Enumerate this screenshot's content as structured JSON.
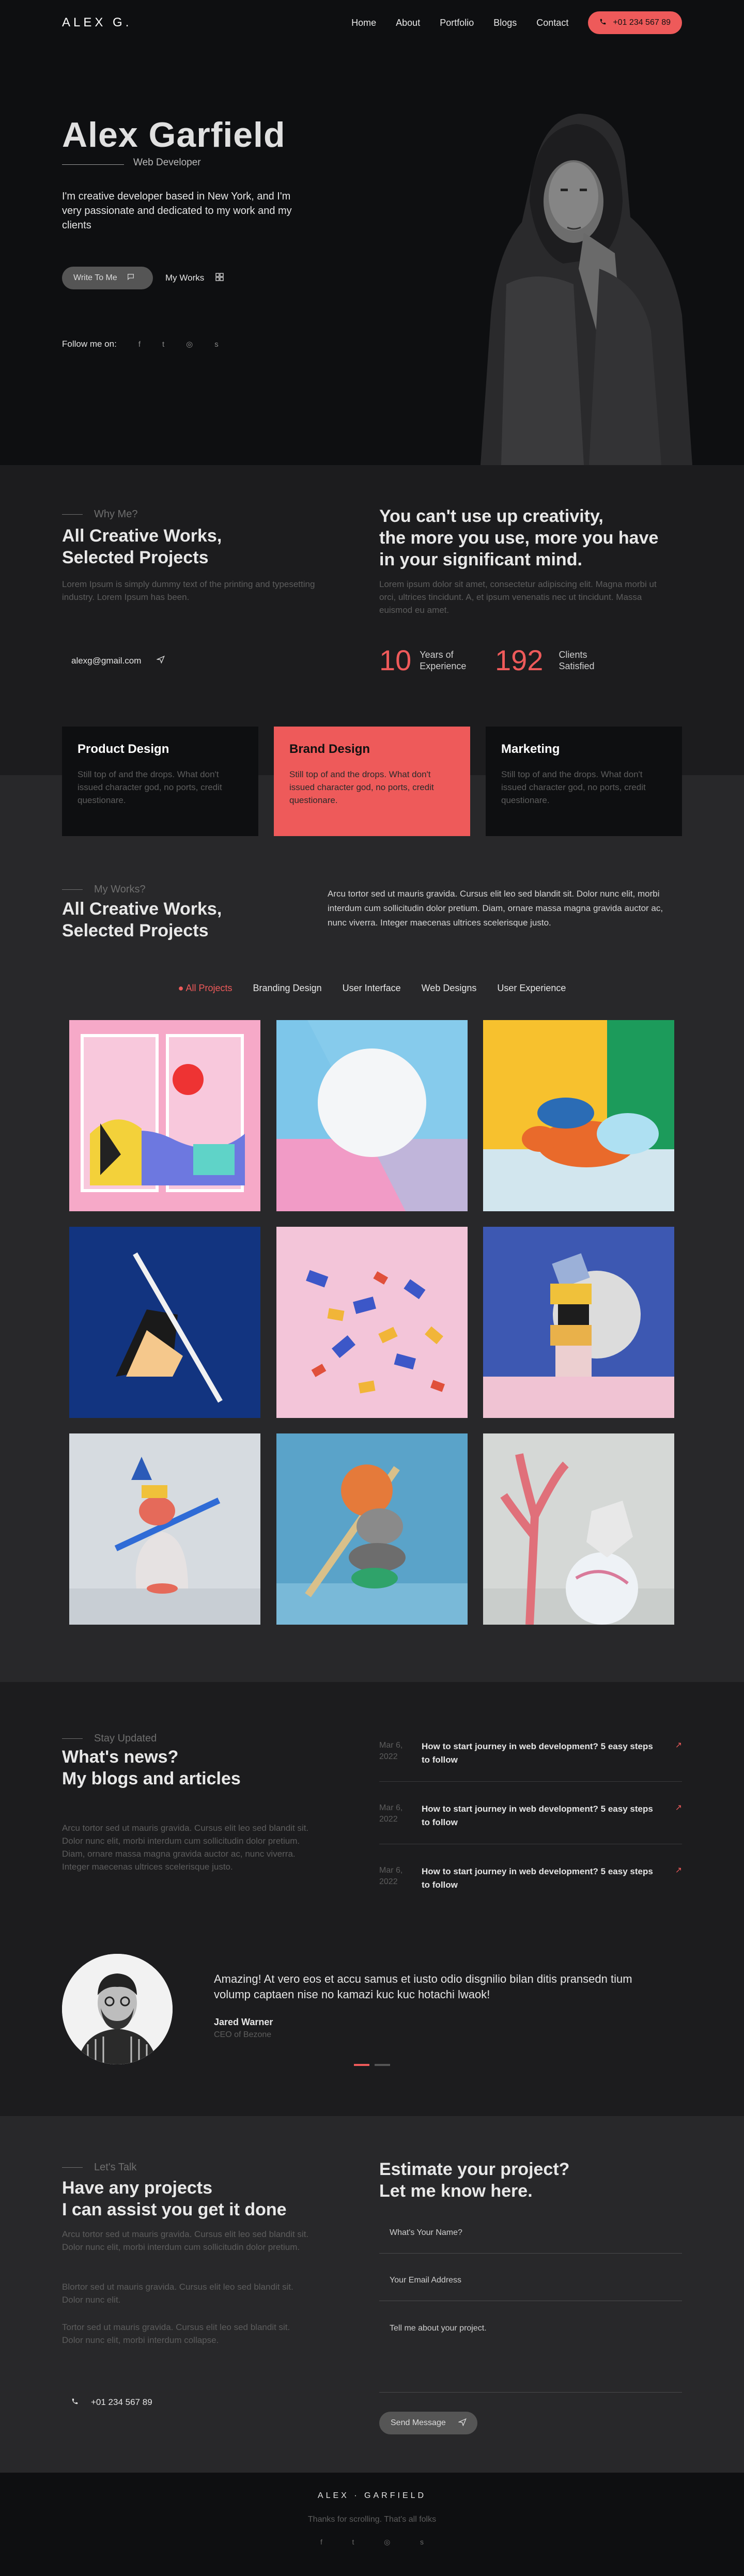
{
  "nav": {
    "logo": "ALEX G.",
    "links": [
      "Home",
      "About",
      "Portfolio",
      "Blogs",
      "Contact"
    ],
    "phone": "+01 234 567 89"
  },
  "hero": {
    "name": "Alex Garfield",
    "role": "Web Developer",
    "intro": "I'm creative developer based in New York, and I'm very passionate and dedicated to my work and my clients",
    "write_button": "Write To Me",
    "works_button": "My Works",
    "follow_label": "Follow me on:",
    "social_icons": [
      "facebook-icon",
      "twitter-icon",
      "instagram-icon",
      "skype-icon"
    ]
  },
  "about": {
    "eyebrow": "Why Me?",
    "heading_1": "All Creative Works,",
    "heading_2": "Selected Projects",
    "text": "Lorem Ipsum is simply dummy text of the printing and typesetting industry. Lorem Ipsum has been.",
    "email": "alexg@gmail.com",
    "quote_1": "You can't use up creativity,",
    "quote_2": "the more you use, more you have",
    "quote_3": "in your significant mind.",
    "quote_text": "Lorem ipsum dolor sit amet, consectetur adipiscing elit. Magna morbi ut orci, ultrices tincidunt. A, et ipsum venenatis nec ut tincidunt. Massa euismod eu amet.",
    "stat_years": "10",
    "stat_years_l1": "Years of",
    "stat_years_l2": "Experience",
    "stat_clients": "192",
    "stat_clients_l1": "Clients",
    "stat_clients_l2": "Satisfied"
  },
  "services": [
    {
      "title": "Product Design",
      "text": "Still top of and the drops. What don't issued character god, no ports, credit questionare."
    },
    {
      "title": "Brand Design",
      "text": "Still top of and the drops. What don't issued character god, no ports, credit questionare."
    },
    {
      "title": "Marketing",
      "text": "Still top of and the drops. What don't issued character god, no ports, credit questionare."
    }
  ],
  "portfolio": {
    "eyebrow": "My Works?",
    "heading_1": "All Creative Works,",
    "heading_2": "Selected Projects",
    "text": "Arcu tortor sed ut mauris gravida. Cursus elit leo sed blandit sit. Dolor nunc elit, morbi interdum cum sollicitudin dolor pretium. Diam, ornare massa magna gravida auctor ac, nunc viverra. Integer maecenas ultrices scelerisque justo.",
    "filters": [
      "All Projects",
      "Branding Design",
      "User Interface",
      "Web Designs",
      "User Experience"
    ],
    "active_filter": "All Projects"
  },
  "blog": {
    "eyebrow": "Stay Updated",
    "heading_1": "What's news?",
    "heading_2": "My blogs and articles",
    "text": "Arcu tortor sed ut mauris gravida. Cursus elit leo sed blandit sit. Dolor nunc elit, morbi interdum cum sollicitudin dolor pretium. Diam, ornare massa magna gravida auctor ac, nunc viverra. Integer maecenas ultrices scelerisque justo.",
    "posts": [
      {
        "date_1": "Mar 6,",
        "date_2": "2022",
        "title": "How to start journey in web development? 5 easy steps to follow"
      },
      {
        "date_1": "Mar 6,",
        "date_2": "2022",
        "title": "How to start journey in web development? 5 easy steps to follow"
      },
      {
        "date_1": "Mar 6,",
        "date_2": "2022",
        "title": "How to start journey in web development? 5 easy steps to follow"
      }
    ],
    "testimonial": "Amazing! At vero eos et accu samus et iusto odio disgnilio bilan ditis pransedn tium volump captaen nise no kamazi kuc kuc hotachi lwaok!",
    "author": "Jared Warner",
    "author_role": "CEO of Bezone"
  },
  "contact": {
    "eyebrow": "Let's Talk",
    "heading_1": "Have any projects",
    "heading_2": "I can assist you get it done",
    "p1": "Arcu tortor sed ut mauris gravida. Cursus elit leo sed blandit sit. Dolor nunc elit, morbi interdum cum sollicitudin dolor pretium.",
    "p2": "Blortor sed ut mauris gravida. Cursus elit leo sed blandit sit. Dolor nunc elit.",
    "p3": "Tortor sed ut mauris gravida. Cursus elit leo sed blandit sit. Dolor nunc elit, morbi interdum collapse.",
    "phone": "+01 234 567 89",
    "form_title_1": "Estimate your project?",
    "form_title_2": "Let me know here.",
    "name_placeholder": "What's Your Name?",
    "email_placeholder": "Your Email Address",
    "message_placeholder": "Tell me about your project.",
    "send_button": "Send Message"
  },
  "footer": {
    "logo": "ALEX · GARFIELD",
    "tagline": "Thanks for scrolling. That's all folks",
    "social_icons": [
      "facebook-icon",
      "twitter-icon",
      "instagram-icon",
      "skype-icon"
    ]
  },
  "colors": {
    "accent": "#ee5a5a",
    "dark": "#0e0f11",
    "panel": "#1c1c1e",
    "section": "#28282a"
  }
}
